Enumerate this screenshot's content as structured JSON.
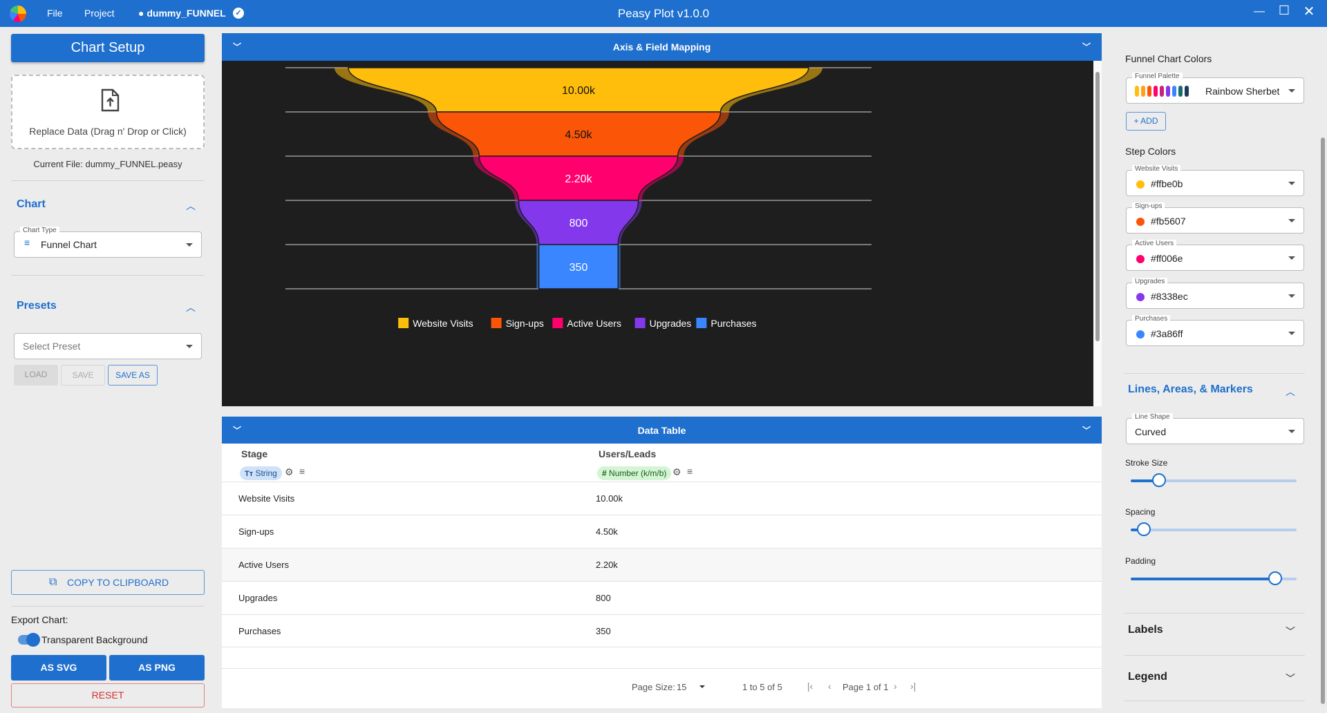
{
  "titlebar": {
    "menu_file": "File",
    "menu_project": "Project",
    "project_name": "● dummy_FUNNEL",
    "app_title": "Peasy Plot v1.0.0"
  },
  "left": {
    "setup_button": "Chart Setup",
    "dropzone_text": "Replace Data (Drag n' Drop or Click)",
    "current_file": "Current File: dummy_FUNNEL.peasy",
    "chart_section": "Chart",
    "chart_type_label": "Chart Type",
    "chart_type_value": "Funnel Chart",
    "presets_section": "Presets",
    "preset_placeholder": "Select Preset",
    "load": "LOAD",
    "save": "SAVE",
    "save_as": "SAVE AS",
    "copy": "COPY TO CLIPBOARD",
    "export_label": "Export Chart:",
    "transparent_label": "Transparent Background",
    "as_svg": "AS SVG",
    "as_png": "AS PNG",
    "reset": "RESET"
  },
  "center": {
    "axis_bar": "Axis & Field Mapping",
    "table_bar": "Data Table",
    "columns": [
      {
        "header": "Stage",
        "type": "String"
      },
      {
        "header": "Users/Leads",
        "type": "Number (k/m/b)"
      }
    ],
    "rows": [
      [
        "Website Visits",
        "10.00k"
      ],
      [
        "Sign-ups",
        "4.50k"
      ],
      [
        "Active Users",
        "2.20k"
      ],
      [
        "Upgrades",
        "800"
      ],
      [
        "Purchases",
        "350"
      ]
    ],
    "footer": {
      "page_size_label": "Page Size:",
      "page_size": "15",
      "range": "1 to 5 of 5",
      "page": "Page 1 of 1"
    }
  },
  "chart_data": {
    "type": "funnel",
    "categories": [
      "Website Visits",
      "Sign-ups",
      "Active Users",
      "Upgrades",
      "Purchases"
    ],
    "values": [
      10000,
      4500,
      2200,
      800,
      350
    ],
    "labels": [
      "10.00k",
      "4.50k",
      "2.20k",
      "800",
      "350"
    ],
    "colors": [
      "#ffbe0b",
      "#fb5607",
      "#ff006e",
      "#8338ec",
      "#3a86ff"
    ],
    "legend": "bottom",
    "background": "#1e1e1e"
  },
  "right": {
    "funnel_colors_title": "Funnel Chart Colors",
    "palette_label": "Funnel Palette",
    "palette_value": "Rainbow Sherbet",
    "add": "ADD",
    "step_colors_title": "Step Colors",
    "steps": [
      {
        "label": "Website Visits",
        "value": "#ffbe0b"
      },
      {
        "label": "Sign-ups",
        "value": "#fb5607"
      },
      {
        "label": "Active Users",
        "value": "#ff006e"
      },
      {
        "label": "Upgrades",
        "value": "#8338ec"
      },
      {
        "label": "Purchases",
        "value": "#3a86ff"
      }
    ],
    "lines_section": "Lines, Areas, & Markers",
    "line_shape_label": "Line Shape",
    "line_shape_value": "Curved",
    "stroke_label": "Stroke Size",
    "stroke_level": 0.17,
    "spacing_label": "Spacing",
    "spacing_level": 0.08,
    "padding_label": "Padding",
    "padding_level": 0.87,
    "labels_section": "Labels",
    "legend_section": "Legend"
  }
}
